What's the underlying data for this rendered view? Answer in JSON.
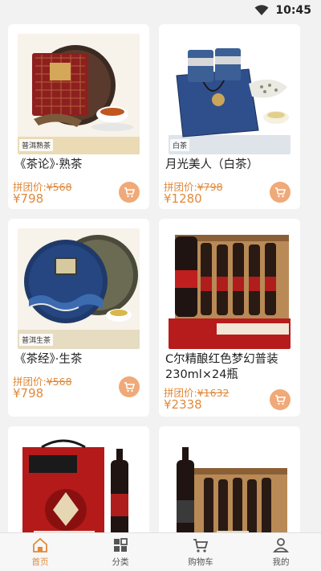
{
  "status_bar": {
    "time": "10:45"
  },
  "products": [
    {
      "title": "《茶论》·熟茶",
      "group_label": "拼团价:",
      "orig_price": "¥568",
      "price": "¥798",
      "img_label": "普洱熟茶"
    },
    {
      "title": "月光美人（白茶）",
      "group_label": "拼团价:",
      "orig_price": "¥798",
      "price": "¥1280",
      "img_label": "白茶"
    },
    {
      "title": "《茶经》·生茶",
      "group_label": "拼团价:",
      "orig_price": "¥568",
      "price": "¥798",
      "img_label": "普洱生茶"
    },
    {
      "title": "C尔精酿红色梦幻普装230ml×24瓶",
      "group_label": "拼团价:",
      "orig_price": "¥1632",
      "price": "¥2338",
      "img_label": ""
    },
    {
      "title": "",
      "group_label": "",
      "orig_price": "",
      "price": "",
      "img_label": ""
    },
    {
      "title": "",
      "group_label": "",
      "orig_price": "",
      "price": "",
      "img_label": ""
    }
  ],
  "tabs": [
    {
      "label": "首页",
      "icon": "home-icon",
      "active": true
    },
    {
      "label": "分类",
      "icon": "category-icon",
      "active": false
    },
    {
      "label": "购物车",
      "icon": "cart-icon",
      "active": false
    },
    {
      "label": "我的",
      "icon": "profile-icon",
      "active": false
    }
  ],
  "colors": {
    "accent": "#e08a3c",
    "cart_bg": "#f0a978"
  }
}
